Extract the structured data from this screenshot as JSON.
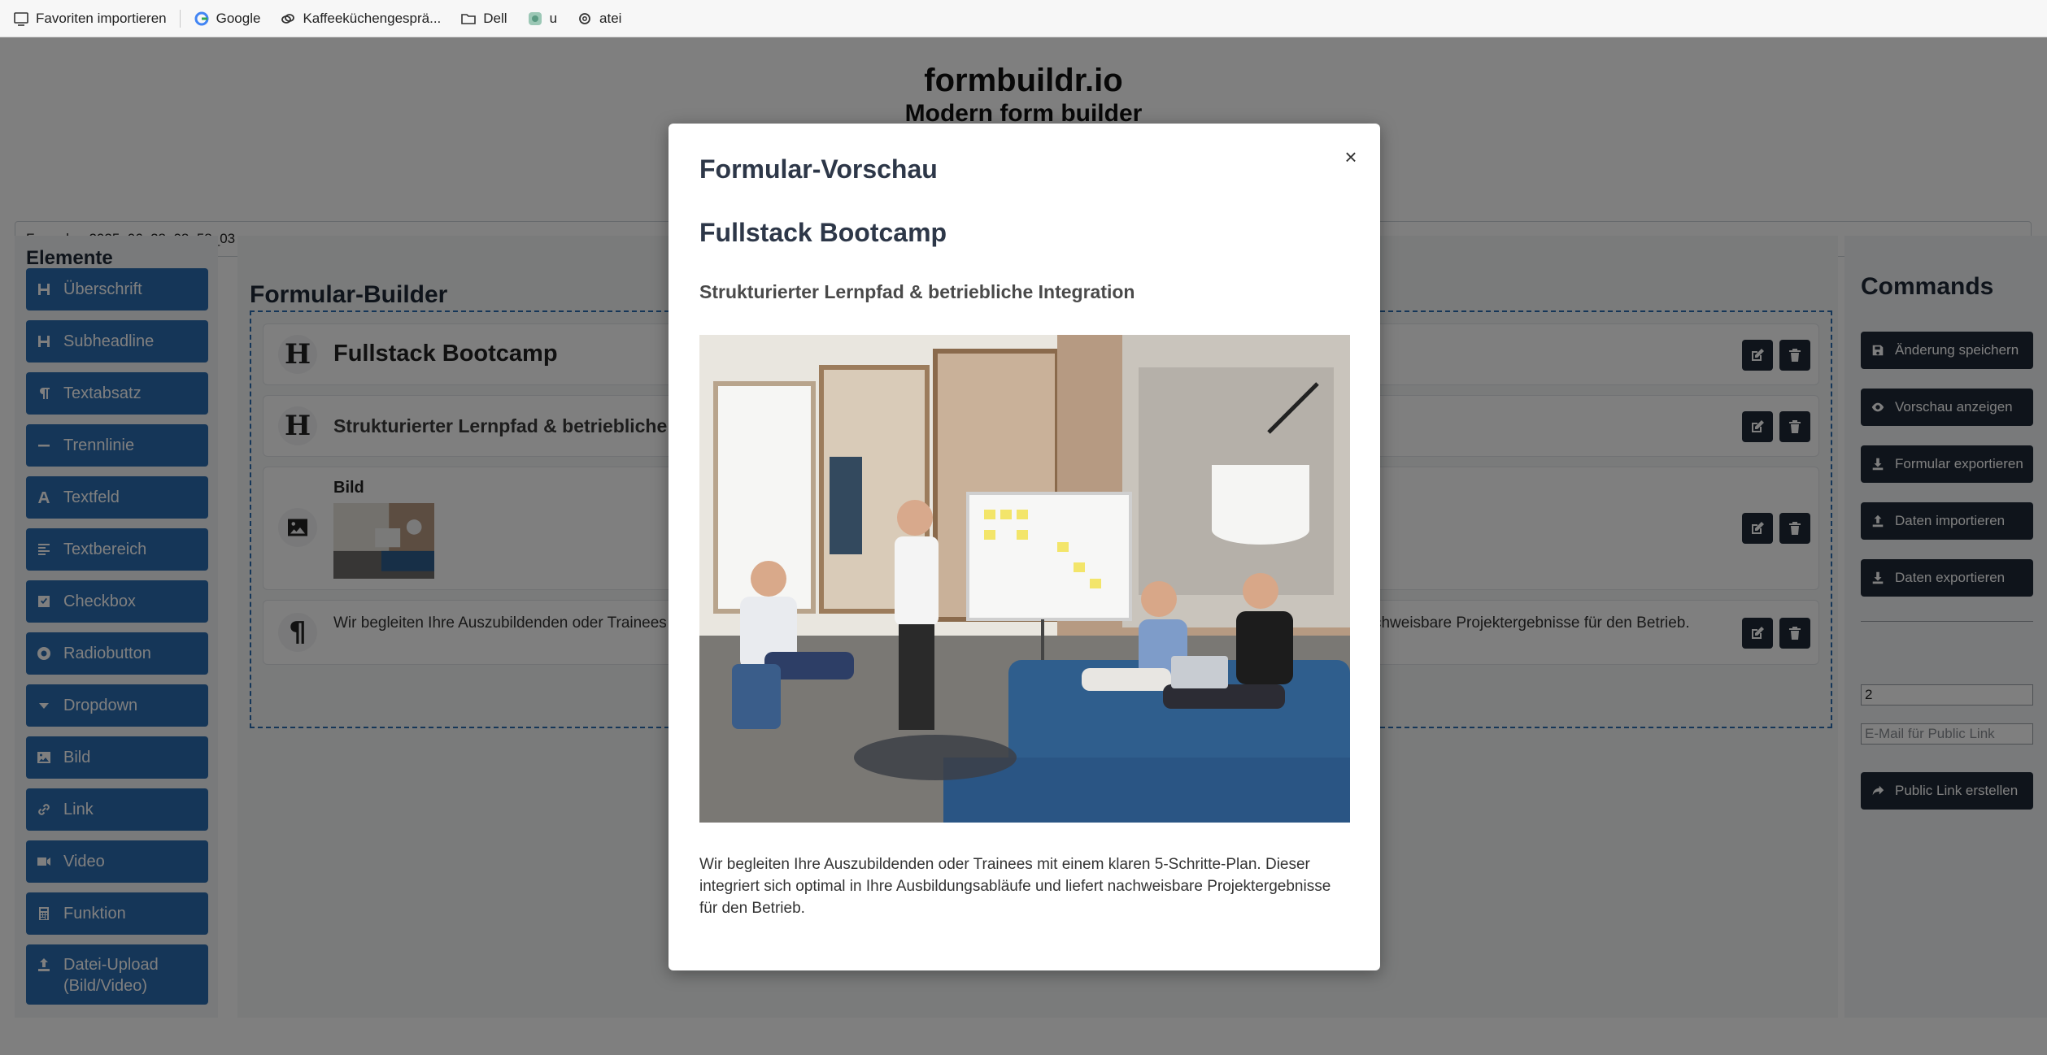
{
  "bookmarks": [
    {
      "label": "Favoriten importieren",
      "icon": "import-icon"
    },
    {
      "label": "Google",
      "icon": "google-icon"
    },
    {
      "label": "Kaffeeküchengesprä...",
      "icon": "link-icon"
    },
    {
      "label": "Dell",
      "icon": "folder-icon"
    },
    {
      "label": "u",
      "icon": "app-icon"
    },
    {
      "label": "atei",
      "icon": "openai-icon"
    }
  ],
  "header": {
    "title": "formbuildr.io",
    "subtitle": "Modern form builder"
  },
  "form_name": "Formular_2025_06_28_08_58_03",
  "elements": {
    "title": "Elemente",
    "items": [
      {
        "label": "Überschrift",
        "icon": "heading-icon"
      },
      {
        "label": "Subheadline",
        "icon": "heading-icon"
      },
      {
        "label": "Textabsatz",
        "icon": "paragraph-icon"
      },
      {
        "label": "Trennlinie",
        "icon": "minus-icon"
      },
      {
        "label": "Textfeld",
        "icon": "font-icon"
      },
      {
        "label": "Textbereich",
        "icon": "align-left-icon"
      },
      {
        "label": "Checkbox",
        "icon": "checkbox-icon"
      },
      {
        "label": "Radiobutton",
        "icon": "radio-icon"
      },
      {
        "label": "Dropdown",
        "icon": "caret-down-icon"
      },
      {
        "label": "Bild",
        "icon": "image-icon"
      },
      {
        "label": "Link",
        "icon": "link-icon"
      },
      {
        "label": "Video",
        "icon": "video-icon"
      },
      {
        "label": "Funktion",
        "icon": "calculator-icon"
      },
      {
        "label": "Datei-Upload (Bild/Video)",
        "icon": "upload-icon"
      }
    ]
  },
  "builder": {
    "title": "Formular-Builder",
    "rows": [
      {
        "type": "heading",
        "text": "Fullstack Bootcamp"
      },
      {
        "type": "subheadline",
        "text": "Strukturierter Lernpfad & betriebliche Integration"
      },
      {
        "type": "image",
        "label": "Bild"
      },
      {
        "type": "paragraph",
        "text": "Wir begleiten Ihre Auszubildenden oder Trainees mit einem klaren 5-Schritte-Plan. Dieser integriert sich optimal in Ihre Ausbildungsabläufe und liefert nachweisbare Projektergebnisse für den Betrieb."
      }
    ]
  },
  "commands": {
    "title": "Commands",
    "buttons": [
      {
        "label": "Änderung speichern",
        "icon": "save-icon"
      },
      {
        "label": "Vorschau anzeigen",
        "icon": "eye-icon"
      },
      {
        "label": "Formular exportieren",
        "icon": "download-icon"
      },
      {
        "label": "Daten importieren",
        "icon": "upload-icon"
      },
      {
        "label": "Daten exportieren",
        "icon": "download-icon"
      }
    ],
    "number_value": "2",
    "email_placeholder": "E-Mail für Public Link",
    "public_link_label": "Public Link erstellen"
  },
  "modal": {
    "title": "Formular-Vorschau",
    "close": "×",
    "heading": "Fullstack Bootcamp",
    "subheadline": "Strukturierter Lernpfad & betriebliche Integration",
    "paragraph": "Wir begleiten Ihre Auszubildenden oder Trainees mit einem klaren 5-Schritte-Plan. Dieser integriert sich optimal in Ihre Ausbildungsabläufe und liefert nachweisbare Projektergebnisse für den Betrieb."
  },
  "colors": {
    "element_button": "#2b6cb0",
    "command_button": "#1f2937",
    "overlay": "rgba(0,0,0,0.5)"
  }
}
